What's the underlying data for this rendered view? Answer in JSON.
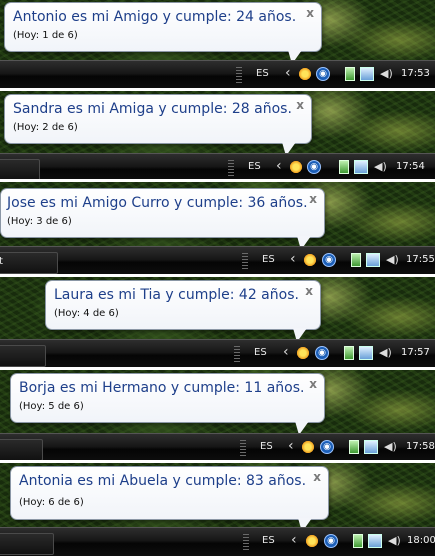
{
  "notifications": [
    {
      "title": "Antonio es mi Amigo y cumple: 24 años.",
      "subtitle": "(Hoy: 1 de 6)",
      "clock": "17:53",
      "lang": "ES",
      "close": "x"
    },
    {
      "title": "Sandra es mi Amiga y cumple: 28 años.",
      "subtitle": "(Hoy: 2 de 6)",
      "clock": "17:54",
      "lang": "ES",
      "close": "x"
    },
    {
      "title": "Jose es mi Amigo Curro y cumple: 36 años.",
      "subtitle": "(Hoy: 3 de 6)",
      "clock": "17:55",
      "lang": "ES",
      "close": "x",
      "tb_text": "t"
    },
    {
      "title": "Laura es mi Tia y cumple: 42 años.",
      "subtitle": "(Hoy: 4 de 6)",
      "clock": "17:57",
      "lang": "ES",
      "close": "x"
    },
    {
      "title": "Borja es mi Hermano y cumple: 11 años.",
      "subtitle": "(Hoy: 5 de 6)",
      "clock": "17:58",
      "lang": "ES",
      "close": "x"
    },
    {
      "title": "Antonia es mi Abuela y cumple: 83 años.",
      "subtitle": "(Hoy: 6 de 6)",
      "clock": "18:00",
      "lang": "ES",
      "close": "x"
    }
  ],
  "icons": {
    "chevron": "chevron-left-icon",
    "volume": "speaker-icon"
  }
}
